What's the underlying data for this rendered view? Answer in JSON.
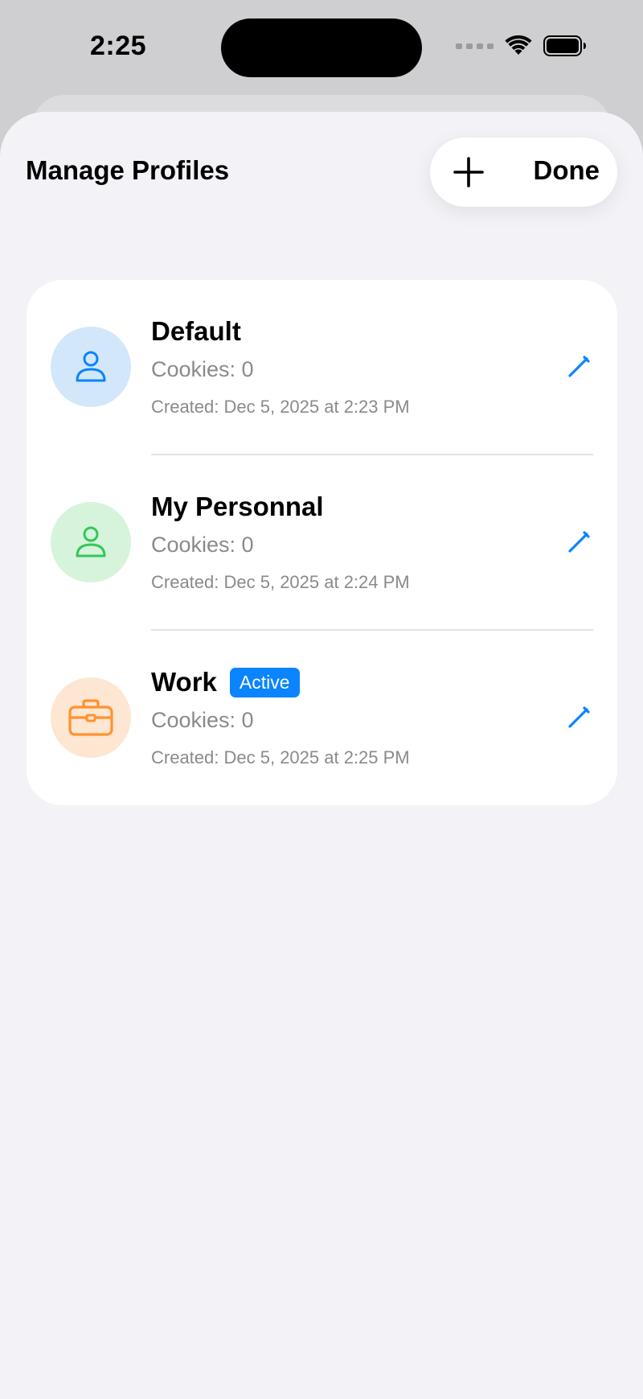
{
  "status_bar": {
    "time": "2:25"
  },
  "header": {
    "title": "Manage Profiles",
    "add_icon": "plus-icon",
    "done_label": "Done"
  },
  "colors": {
    "accent": "#0a84ff",
    "default_avatar_bg": "#d3e7fb",
    "default_avatar_fg": "#0a84ff",
    "personal_avatar_bg": "#d6f3dc",
    "personal_avatar_fg": "#34c759",
    "work_avatar_bg": "#fde6d2",
    "work_avatar_fg": "#ff9230"
  },
  "profiles": [
    {
      "name": "Default",
      "icon": "person-icon",
      "cookies": "Cookies: 0",
      "created": "Created: Dec 5, 2025 at 2:23 PM",
      "badge": ""
    },
    {
      "name": "My Personnal",
      "icon": "person-icon",
      "cookies": "Cookies: 0",
      "created": "Created: Dec 5, 2025 at 2:24 PM",
      "badge": ""
    },
    {
      "name": "Work",
      "icon": "briefcase-icon",
      "cookies": "Cookies: 0",
      "created": "Created: Dec 5, 2025 at 2:25 PM",
      "badge": "Active"
    }
  ]
}
